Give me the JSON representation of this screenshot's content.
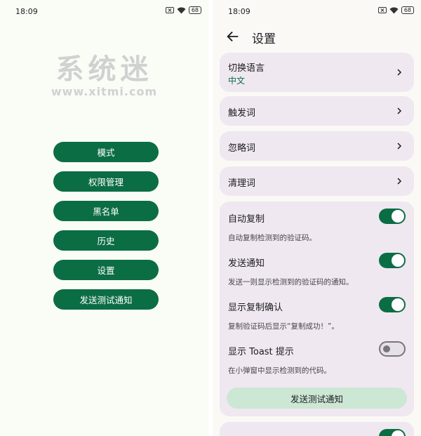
{
  "status_bar": {
    "time": "18:09",
    "battery": "68"
  },
  "left_screen": {
    "watermark": {
      "text": "系统迷",
      "url": "www.xitmi.com"
    },
    "buttons": [
      {
        "label": "模式"
      },
      {
        "label": "权限管理"
      },
      {
        "label": "黑名单"
      },
      {
        "label": "历史"
      },
      {
        "label": "设置"
      },
      {
        "label": "发送测试通知"
      }
    ]
  },
  "right_screen": {
    "title": "设置",
    "language": {
      "label": "切换语言",
      "value": "中文"
    },
    "nav_items": [
      {
        "label": "触发词"
      },
      {
        "label": "忽略词"
      },
      {
        "label": "清理词"
      }
    ],
    "toggles": [
      {
        "label": "自动复制",
        "desc": "自动复制检测到的验证码。",
        "on": true
      },
      {
        "label": "发送通知",
        "desc": "发送一则显示检测到的验证码的通知。",
        "on": true
      },
      {
        "label": "显示复制确认",
        "desc": "复制验证码后显示“复制成功！”。",
        "on": true
      },
      {
        "label": "显示 Toast 提示",
        "desc": "在小弹窗中显示检测到的代码。",
        "on": false
      }
    ],
    "test_button": "发送测试通知"
  },
  "colors": {
    "primary": "#0b6d44",
    "card": "#efe8f0",
    "tonal_button": "#cde7d5"
  }
}
